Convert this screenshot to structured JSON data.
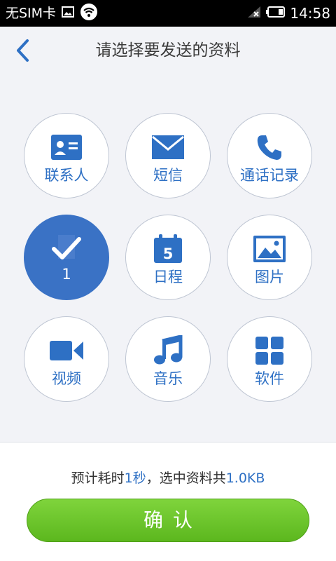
{
  "status_bar": {
    "carrier": "无SIM卡",
    "time": "14:58",
    "icons": [
      "image-icon",
      "wifi-icon",
      "no-signal-icon",
      "battery-icon"
    ]
  },
  "header": {
    "title": "请选择要发送的资料",
    "back_icon": "chevron-left-icon"
  },
  "colors": {
    "accent": "#2e70c4",
    "selected_fill": "#3a72c5",
    "confirm_green": "#6cc52a",
    "tile_border": "#bfc6d3"
  },
  "tiles": [
    {
      "label": "联系人",
      "icon": "contact-card-icon",
      "selected": false
    },
    {
      "label": "短信",
      "icon": "envelope-icon",
      "selected": false
    },
    {
      "label": "通话记录",
      "icon": "phone-icon",
      "selected": false
    },
    {
      "label": "1",
      "icon": "checkmark-icon",
      "selected": true
    },
    {
      "label": "日程",
      "icon": "calendar-icon",
      "calendar_day": "5",
      "selected": false
    },
    {
      "label": "图片",
      "icon": "picture-icon",
      "selected": false
    },
    {
      "label": "视频",
      "icon": "video-camera-icon",
      "selected": false
    },
    {
      "label": "音乐",
      "icon": "music-note-icon",
      "selected": false
    },
    {
      "label": "软件",
      "icon": "apps-grid-icon",
      "selected": false
    }
  ],
  "footer": {
    "summary_prefix": "预计耗时",
    "time_value": "1秒",
    "summary_mid": "，选中资料共",
    "size_value": "1.0KB",
    "confirm_label": "确认"
  }
}
